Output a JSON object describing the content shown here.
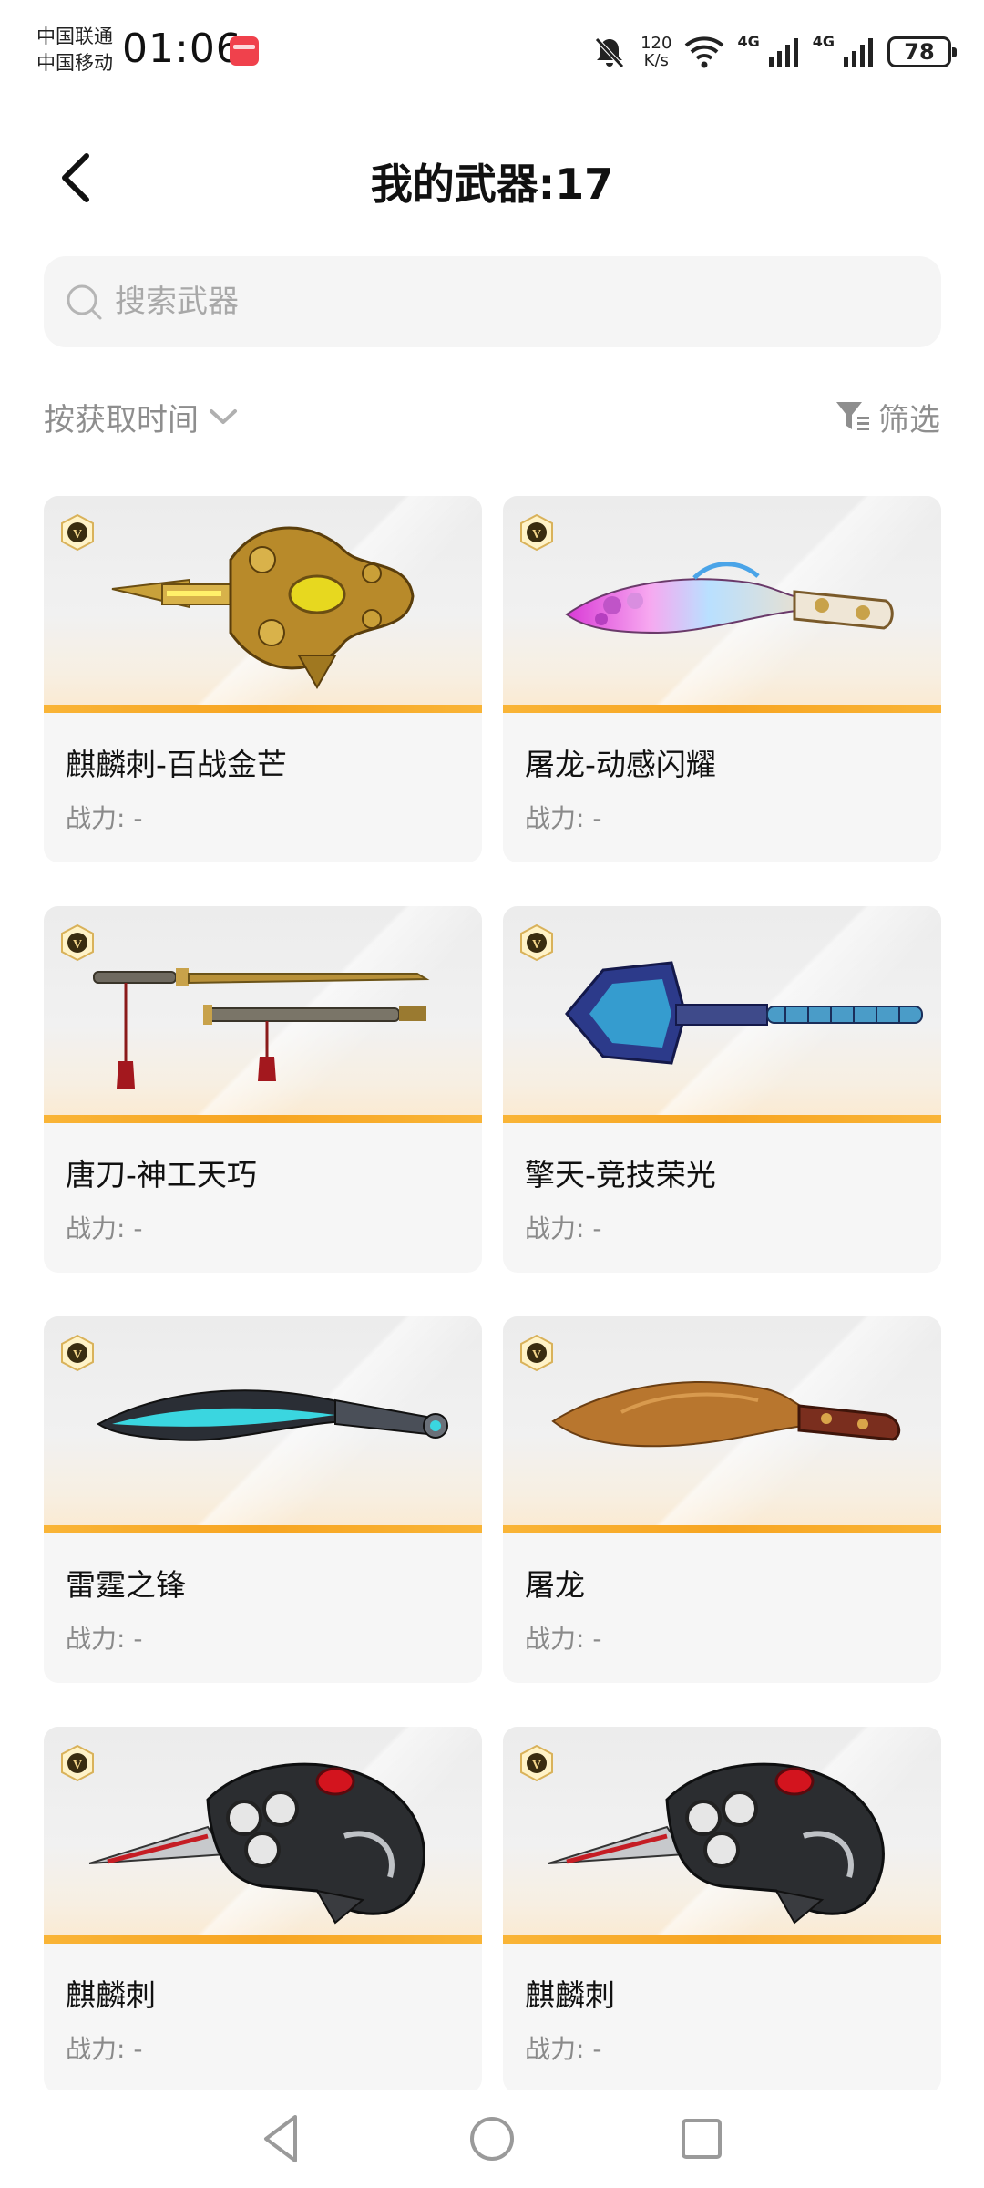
{
  "status_bar": {
    "carrier_1": "中国联通",
    "carrier_2": "中国移动",
    "time": "01:06",
    "net_speed_value": "120",
    "net_speed_unit": "K/s",
    "network_1": "4G",
    "network_2": "4G",
    "battery": "78",
    "icons": [
      "mute-icon",
      "wifi-icon",
      "signal-icon",
      "battery-icon"
    ]
  },
  "header": {
    "title": "我的武器:17"
  },
  "search": {
    "placeholder": "搜索武器",
    "value": ""
  },
  "toolbar": {
    "sort_label": "按获取时间",
    "filter_label": "筛选"
  },
  "colors": {
    "accent_orange": "#f7a521",
    "card_background": "#f6f6f6",
    "muted_text": "#8e8e8e"
  },
  "weapons": [
    {
      "name": "麒麟刺-百战金芒",
      "power": "战力: -",
      "icon": "golden-knuckle-dagger"
    },
    {
      "name": "屠龙-动感闪耀",
      "power": "战力: -",
      "icon": "colorful-kukri"
    },
    {
      "name": "唐刀-神工天巧",
      "power": "战力: -",
      "icon": "tang-sword-pair"
    },
    {
      "name": "擎天-竞技荣光",
      "power": "战力: -",
      "icon": "blue-shovel"
    },
    {
      "name": "雷霆之锋",
      "power": "战力: -",
      "icon": "cyan-blade"
    },
    {
      "name": "屠龙",
      "power": "战力: -",
      "icon": "bronze-kukri"
    },
    {
      "name": "麒麟刺",
      "power": "战力: -",
      "icon": "silver-knuckle-dagger"
    },
    {
      "name": "麒麟刺",
      "power": "战力: -",
      "icon": "silver-knuckle-dagger"
    }
  ]
}
